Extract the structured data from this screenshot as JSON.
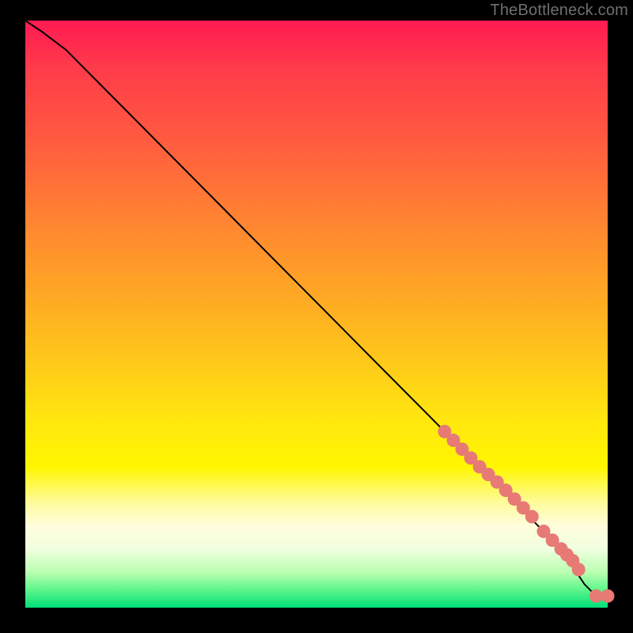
{
  "attribution": "TheBottleneck.com",
  "colors": {
    "background": "#000000",
    "attribution_text": "#6f6f6f",
    "line": "#000000",
    "marker_fill": "#e77a74",
    "marker_stroke": "#d85f5a",
    "gradient_stops": [
      "#ff1a52",
      "#ff3b4a",
      "#ff5a40",
      "#ff7e33",
      "#ffa326",
      "#ffc81a",
      "#ffe70f",
      "#fff600",
      "#fffb9a",
      "#fffddc",
      "#f0ffe0",
      "#b9ffb0",
      "#5cf58a",
      "#00e079"
    ]
  },
  "chart_data": {
    "type": "line",
    "title": "",
    "xlabel": "",
    "ylabel": "",
    "xlim": [
      0,
      100
    ],
    "ylim": [
      0,
      100
    ],
    "grid": false,
    "line": {
      "x": [
        0,
        3,
        7,
        12,
        18,
        25,
        33,
        42,
        51,
        60,
        68,
        75,
        80,
        84,
        87,
        90,
        92,
        94,
        96,
        98,
        100
      ],
      "y": [
        100,
        98,
        95,
        90,
        84,
        77,
        69,
        60,
        51,
        42,
        34,
        27,
        22,
        18,
        15,
        12,
        9,
        7,
        4,
        2,
        2
      ]
    },
    "markers": {
      "x": [
        72,
        73.5,
        75,
        76.5,
        78,
        79.5,
        81,
        82.5,
        84,
        85.5,
        87,
        89,
        90.5,
        92,
        93,
        94,
        95,
        98,
        100
      ],
      "y": [
        30,
        28.5,
        27,
        25.5,
        24,
        22.7,
        21.4,
        20,
        18.5,
        17,
        15.5,
        13,
        11.5,
        10,
        9,
        8,
        6.5,
        2,
        2
      ]
    }
  }
}
